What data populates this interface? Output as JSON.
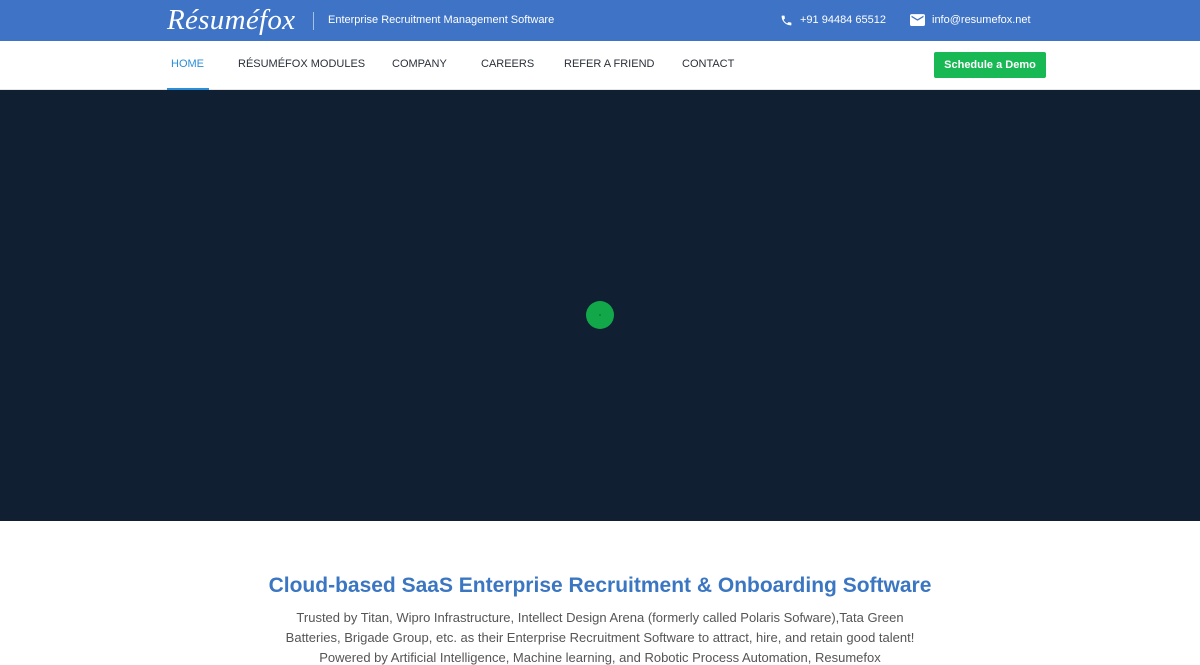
{
  "topbar": {
    "logo": "Résuméfox",
    "tagline": "Enterprise Recruitment Management Software",
    "phone": "+91 94484 65512",
    "email": "info@resumefox.net",
    "phone_icon": "phone-icon",
    "email_icon": "envelope-icon"
  },
  "nav": {
    "items": [
      {
        "label": "HOME",
        "active": true
      },
      {
        "label": "RÉSUMÉFOX MODULES",
        "active": false
      },
      {
        "label": "COMPANY",
        "active": false
      },
      {
        "label": "CAREERS",
        "active": false
      },
      {
        "label": "REFER A FRIEND",
        "active": false
      },
      {
        "label": "CONTACT",
        "active": false
      }
    ],
    "demo_button": "Schedule a Demo"
  },
  "hero": {
    "loader": "loading-spinner"
  },
  "intro": {
    "title": "Cloud-based SaaS Enterprise Recruitment & Onboarding Software",
    "body": "Trusted by Titan, Wipro Infrastructure, Intellect Design Arena (formerly called Polaris Sofware),Tata Green Batteries, Brigade Group, etc. as their Enterprise Recruitment Software to attract, hire, and retain good talent! Powered by Artificial Intelligence, Machine learning, and Robotic Process Automation, Resumefox"
  },
  "colors": {
    "topbar": "#3e73c6",
    "hero": "#101f32",
    "accent_green": "#18b855",
    "nav_active": "#2a8fd8",
    "title_blue": "#3b76c2"
  }
}
